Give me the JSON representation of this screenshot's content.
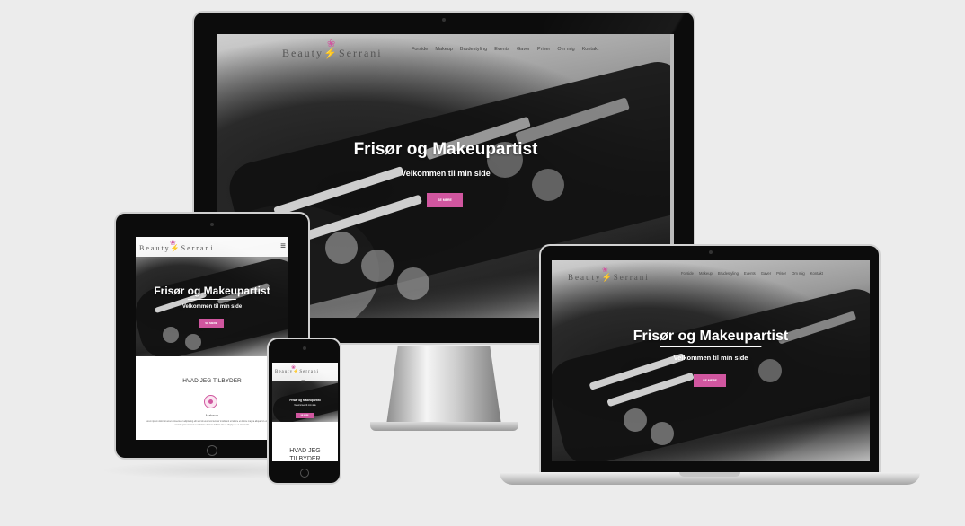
{
  "site": {
    "logo_text": "Beauty",
    "logo_text2": "Serrani",
    "lotus_glyph": "❀",
    "nav": [
      "Forside",
      "Makeup",
      "Brudestyling",
      "Events",
      "Gaver",
      "Priser",
      "Om mig",
      "Kontakt"
    ],
    "hero_title": "Frisør og Makeupartist",
    "hero_subtitle": "Velkommen til min side",
    "hero_button": "SE MERE",
    "offer_heading": "HVAD JEG TILBYDER",
    "offer_item": "Makeup",
    "offer_text": "Lorem ipsum dolor sit amet consectetur adipiscing elit sed do eiusmod tempor incididunt ut labore et dolore magna aliqua. Ut enim ad minim veniam quis nostrud exercitation ullamco laboris nisi ut aliquip ex ea commodo.",
    "hamburger": "≡",
    "phone_heading": "HVAD JEG TILBYDER"
  },
  "colors": {
    "accent": "#d0569f",
    "background": "#ececec"
  }
}
